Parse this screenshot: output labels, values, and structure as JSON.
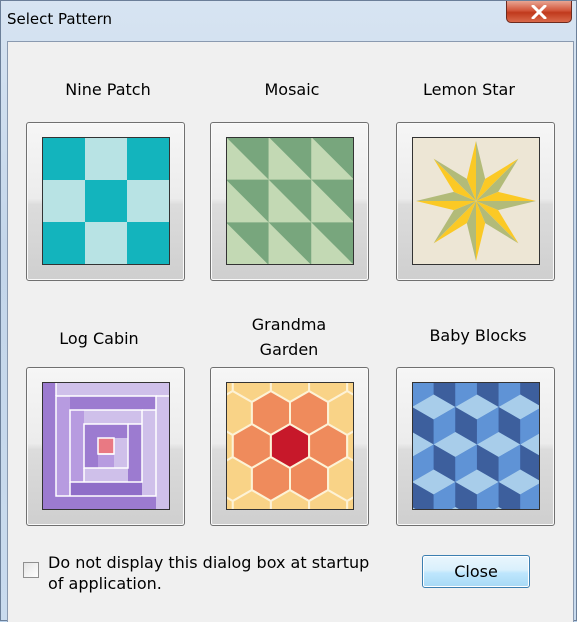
{
  "window": {
    "title": "Select Pattern"
  },
  "patterns": [
    {
      "label": "Nine Patch"
    },
    {
      "label": "Mosaic"
    },
    {
      "label": "Lemon Star"
    },
    {
      "label_line1": "Log Cabin"
    },
    {
      "label_line1": "Grandma",
      "label_line2": "Garden"
    },
    {
      "label_line1": "Baby Blocks"
    }
  ],
  "startup_checkbox": {
    "label_line1": "Do not display this dialog box at startup",
    "label_line2": "of application.",
    "checked": false
  },
  "close_button": {
    "label": "Close"
  },
  "icons": {
    "close": "close-x-icon"
  }
}
